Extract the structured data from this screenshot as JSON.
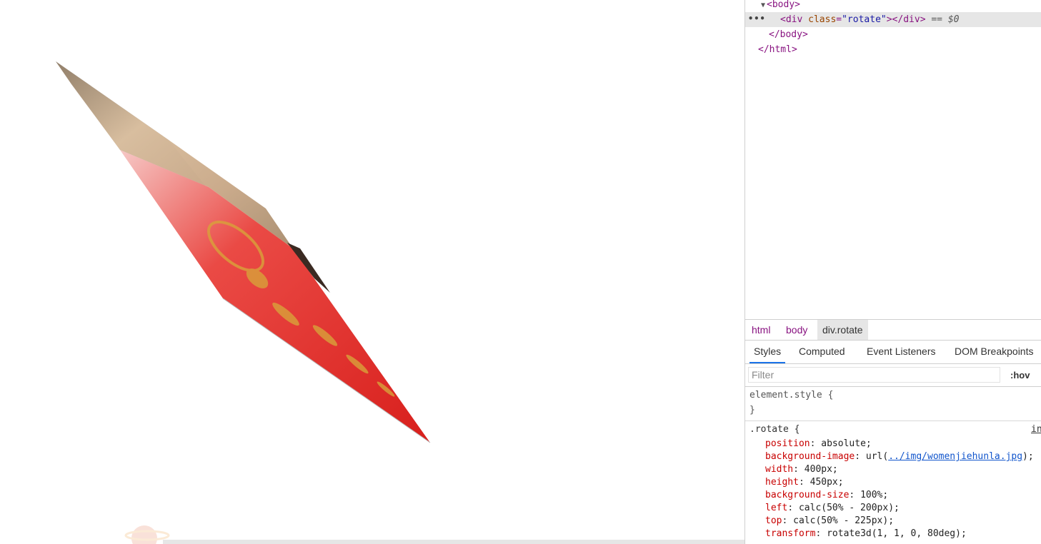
{
  "viewport": {
    "card_colors": {
      "red": "#e4302c",
      "pink": "#f3a8a6",
      "tan": "#c9ad8c",
      "blue_gray": "#b7c1cf"
    }
  },
  "devtools": {
    "dom": {
      "body_open": "<body>",
      "div_tag_open": "<div",
      "div_attr_name": "class",
      "div_attr_value": "\"rotate\"",
      "div_close": "></div>",
      "eq_zero": "== $0",
      "body_close": "</body>",
      "html_close": "</html>",
      "ellipsis": "•••"
    },
    "breadcrumbs": [
      "html",
      "body",
      "div.rotate"
    ],
    "tabs": [
      "Styles",
      "Computed",
      "Event Listeners",
      "DOM Breakpoints"
    ],
    "filter": {
      "placeholder": "Filter",
      "hov_label": ":hov"
    },
    "styles": {
      "element_style_selector": "element.style {",
      "close_brace": "}",
      "rule_selector": ".rotate {",
      "source_label": "in",
      "properties": [
        {
          "name": "position",
          "value": "absolute;"
        },
        {
          "name": "background-image",
          "value_prefix": "url(",
          "url": "../img/womenjiehunla.jpg",
          "value_suffix": ");"
        },
        {
          "name": "width",
          "value": "400px;"
        },
        {
          "name": "height",
          "value": "450px;"
        },
        {
          "name": "background-size",
          "value": "100%;"
        },
        {
          "name": "left",
          "value": "calc(50% - 200px);"
        },
        {
          "name": "top",
          "value": "calc(50% - 225px);"
        },
        {
          "name": "transform",
          "value": "rotate3d(1, 1, 0, 80deg);"
        }
      ]
    }
  }
}
